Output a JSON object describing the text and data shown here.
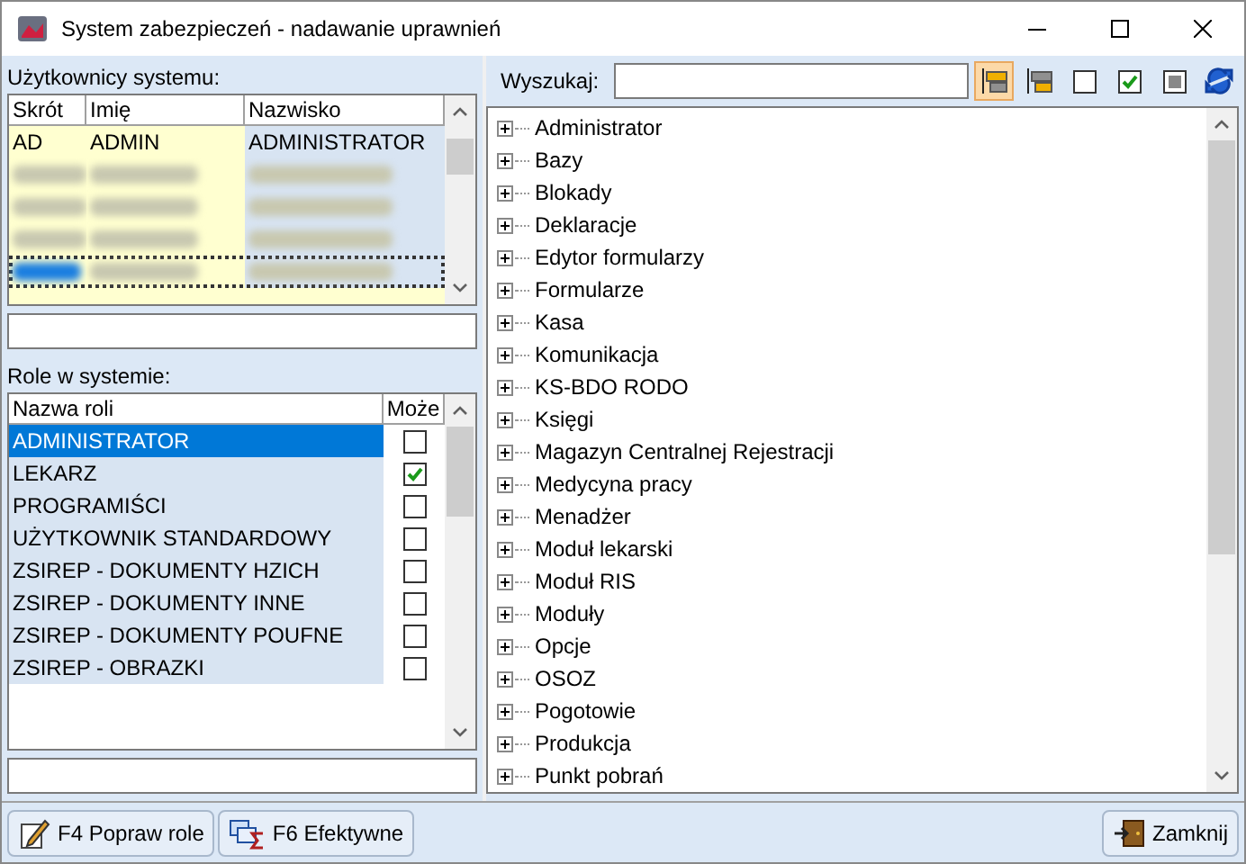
{
  "window": {
    "title": "System zabezpieczeń - nadawanie uprawnień"
  },
  "users": {
    "label": "Użytkownicy systemu:",
    "columns": [
      "Skrót",
      "Imię",
      "Nazwisko"
    ],
    "rows": [
      {
        "cells": [
          "AD",
          "ADMIN",
          "ADMINISTRATOR"
        ],
        "redacted": false,
        "selected": false
      },
      {
        "redacted": true,
        "selected": false
      },
      {
        "redacted": true,
        "selected": false
      },
      {
        "redacted": true,
        "selected": false
      },
      {
        "redacted": true,
        "selected": true
      }
    ]
  },
  "roles": {
    "label": "Role w systemie:",
    "columns": [
      "Nazwa roli",
      "Może"
    ],
    "rows": [
      {
        "name": "ADMINISTRATOR",
        "checked": false,
        "selected": true
      },
      {
        "name": "LEKARZ",
        "checked": true,
        "selected": false
      },
      {
        "name": "PROGRAMIŚCI",
        "checked": false,
        "selected": false
      },
      {
        "name": "UŻYTKOWNIK STANDARDOWY",
        "checked": false,
        "selected": false
      },
      {
        "name": "ZSIREP - DOKUMENTY HZICH",
        "checked": false,
        "selected": false
      },
      {
        "name": "ZSIREP - DOKUMENTY INNE",
        "checked": false,
        "selected": false
      },
      {
        "name": "ZSIREP - DOKUMENTY POUFNE",
        "checked": false,
        "selected": false
      },
      {
        "name": "ZSIREP - OBRAZKI",
        "checked": false,
        "selected": false
      }
    ]
  },
  "search": {
    "label": "Wyszukaj:"
  },
  "toolbar": [
    {
      "kind": "tree-a",
      "selected": true
    },
    {
      "kind": "tree-b",
      "selected": false
    },
    {
      "kind": "box-empty",
      "selected": false
    },
    {
      "kind": "box-check",
      "selected": false
    },
    {
      "kind": "box-fill",
      "selected": false
    },
    {
      "kind": "refresh",
      "selected": false
    }
  ],
  "tree": {
    "items": [
      {
        "label": "Administrator",
        "expanded": false
      },
      {
        "label": "Bazy",
        "expanded": false
      },
      {
        "label": "Blokady",
        "expanded": false
      },
      {
        "label": "Deklaracje",
        "expanded": false
      },
      {
        "label": "Edytor formularzy",
        "expanded": false
      },
      {
        "label": "Formularze",
        "expanded": false
      },
      {
        "label": "Kasa",
        "expanded": false
      },
      {
        "label": "Komunikacja",
        "expanded": false
      },
      {
        "label": "KS-BDO RODO",
        "expanded": false
      },
      {
        "label": "Księgi",
        "expanded": false
      },
      {
        "label": "Magazyn Centralnej Rejestracji",
        "expanded": false
      },
      {
        "label": "Medycyna pracy",
        "expanded": false
      },
      {
        "label": "Menadżer",
        "expanded": false
      },
      {
        "label": "Moduł lekarski",
        "expanded": false
      },
      {
        "label": "Moduł RIS",
        "expanded": false
      },
      {
        "label": "Moduły",
        "expanded": false
      },
      {
        "label": "Opcje",
        "expanded": false
      },
      {
        "label": "OSOZ",
        "expanded": false
      },
      {
        "label": "Pogotowie",
        "expanded": false
      },
      {
        "label": "Produkcja",
        "expanded": false
      },
      {
        "label": "Punkt pobrań",
        "expanded": false
      }
    ]
  },
  "buttons": [
    {
      "kind": "edit",
      "label": "F4 Popraw role"
    },
    {
      "kind": "effective",
      "label": "F6 Efektywne"
    },
    {
      "kind": "close",
      "label": "Zamknij"
    }
  ]
}
